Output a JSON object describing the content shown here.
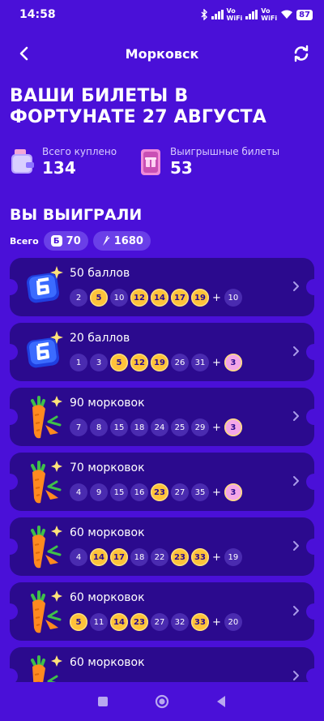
{
  "status": {
    "time": "14:58",
    "battery": "87",
    "net1": "Vo\nWiFi",
    "net2": "Vo\nWiFi"
  },
  "appbar": {
    "title": "Морковск"
  },
  "headline": "ВАШИ БИЛЕТЫ В ФОРТУНАТЕ 27 АВГУСТА",
  "stats": {
    "bought_label": "Всего куплено",
    "bought_value": "134",
    "winning_label": "Выигрышные билеты",
    "winning_value": "53"
  },
  "won": {
    "title": "ВЫ ВЫИГРАЛИ",
    "total_label": "Всего",
    "points_icon": "Б",
    "points": "70",
    "carrots": "1680"
  },
  "tickets": [
    {
      "prize": "50 баллов",
      "kind": "points",
      "numbers": [
        {
          "n": "2"
        },
        {
          "n": "5",
          "hit": true
        },
        {
          "n": "10"
        },
        {
          "n": "12",
          "hit": true
        },
        {
          "n": "14",
          "hit": true
        },
        {
          "n": "17",
          "hit": true
        },
        {
          "n": "19",
          "hit": true
        }
      ],
      "bonus": {
        "n": "10",
        "hit": false
      }
    },
    {
      "prize": "20 баллов",
      "kind": "points",
      "numbers": [
        {
          "n": "1"
        },
        {
          "n": "3"
        },
        {
          "n": "5",
          "hit": true
        },
        {
          "n": "12",
          "hit": true
        },
        {
          "n": "19",
          "hit": true
        },
        {
          "n": "26"
        },
        {
          "n": "31"
        }
      ],
      "bonus": {
        "n": "3",
        "hit": true
      }
    },
    {
      "prize": "90 морковок",
      "kind": "carrot",
      "numbers": [
        {
          "n": "7"
        },
        {
          "n": "8"
        },
        {
          "n": "15"
        },
        {
          "n": "18"
        },
        {
          "n": "24"
        },
        {
          "n": "25"
        },
        {
          "n": "29"
        }
      ],
      "bonus": {
        "n": "3",
        "hit": true
      }
    },
    {
      "prize": "70 морковок",
      "kind": "carrot",
      "numbers": [
        {
          "n": "4"
        },
        {
          "n": "9"
        },
        {
          "n": "15"
        },
        {
          "n": "16"
        },
        {
          "n": "23",
          "hit": true
        },
        {
          "n": "27"
        },
        {
          "n": "35"
        }
      ],
      "bonus": {
        "n": "3",
        "hit": true
      }
    },
    {
      "prize": "60 морковок",
      "kind": "carrot",
      "numbers": [
        {
          "n": "4"
        },
        {
          "n": "14",
          "hit": true
        },
        {
          "n": "17",
          "hit": true
        },
        {
          "n": "18"
        },
        {
          "n": "22"
        },
        {
          "n": "23",
          "hit": true
        },
        {
          "n": "33",
          "hit": true
        }
      ],
      "bonus": {
        "n": "19",
        "hit": false
      }
    },
    {
      "prize": "60 морковок",
      "kind": "carrot",
      "numbers": [
        {
          "n": "5",
          "hit": true
        },
        {
          "n": "11"
        },
        {
          "n": "14",
          "hit": true
        },
        {
          "n": "23",
          "hit": true
        },
        {
          "n": "27"
        },
        {
          "n": "32"
        },
        {
          "n": "33",
          "hit": true
        }
      ],
      "bonus": {
        "n": "20",
        "hit": false
      }
    },
    {
      "prize": "60 морковок",
      "kind": "carrot",
      "numbers": [],
      "bonus": null
    }
  ],
  "icons": {
    "back": "arrow-left-icon",
    "refresh": "refresh-icon",
    "chevron": "chevron-right-icon"
  },
  "colors": {
    "background": "#4a10d8",
    "card": "#2b0a8e",
    "ball": "#4a2bb0",
    "hit": "#ffc23a",
    "bonus_hit": "#f4a6e8"
  }
}
